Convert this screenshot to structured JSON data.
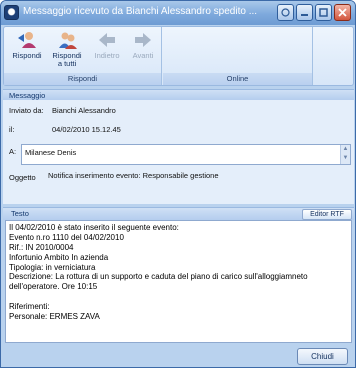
{
  "window": {
    "title": "Messaggio ricevuto da Bianchi Alessandro spedito ...",
    "controls": [
      "help-icon",
      "minimize-icon",
      "maximize-icon",
      "close-icon"
    ]
  },
  "ribbon": {
    "rispondi_group": {
      "label": "Rispondi",
      "buttons": [
        {
          "label": "Rispondi",
          "icon": "reply-person-icon",
          "enabled": true
        },
        {
          "label1": "Rispondi",
          "label2": "a tutti",
          "icon": "reply-all-people-icon",
          "enabled": true
        },
        {
          "label": "Indietro",
          "icon": "arrow-left-icon",
          "enabled": false
        },
        {
          "label": "Avanti",
          "icon": "arrow-right-icon",
          "enabled": false
        }
      ]
    },
    "online_group": {
      "label": "Online"
    }
  },
  "messaggio": {
    "section_title": "Messaggio",
    "inviato_da_label": "Inviato da:",
    "inviato_da_value": "Bianchi Alessandro",
    "il_label": "il:",
    "il_value": "04/02/2010 15.12.45",
    "a_label": "A:",
    "a_value": "Milanese Denis",
    "oggetto_label": "Oggetto",
    "oggetto_value": "Notifica inserimento evento: Responsabile gestione"
  },
  "testo": {
    "section_title": "Testo",
    "editor_button": "Editor RTF",
    "lines": [
      "Il 04/02/2010 è stato inserito il seguente evento:",
      "Evento n.ro 1110 del 04/02/2010",
      "Rif.:  IN 2010/0004",
      "Infortunio Ambito In azienda",
      "Tipologia: in verniciatura",
      "Descrizione: La rottura di un supporto e caduta del piano di carico sull'alloggiamneto",
      "dell'operatore. Ore 10:15",
      "",
      "Riferimenti:",
      "Personale: ERMES ZAVA"
    ]
  },
  "footer": {
    "close_button": "Chiudi"
  },
  "colors": {
    "accent": "#3c6aa8",
    "panel": "#e4eefa",
    "titlebar": "#7ea9dc"
  }
}
